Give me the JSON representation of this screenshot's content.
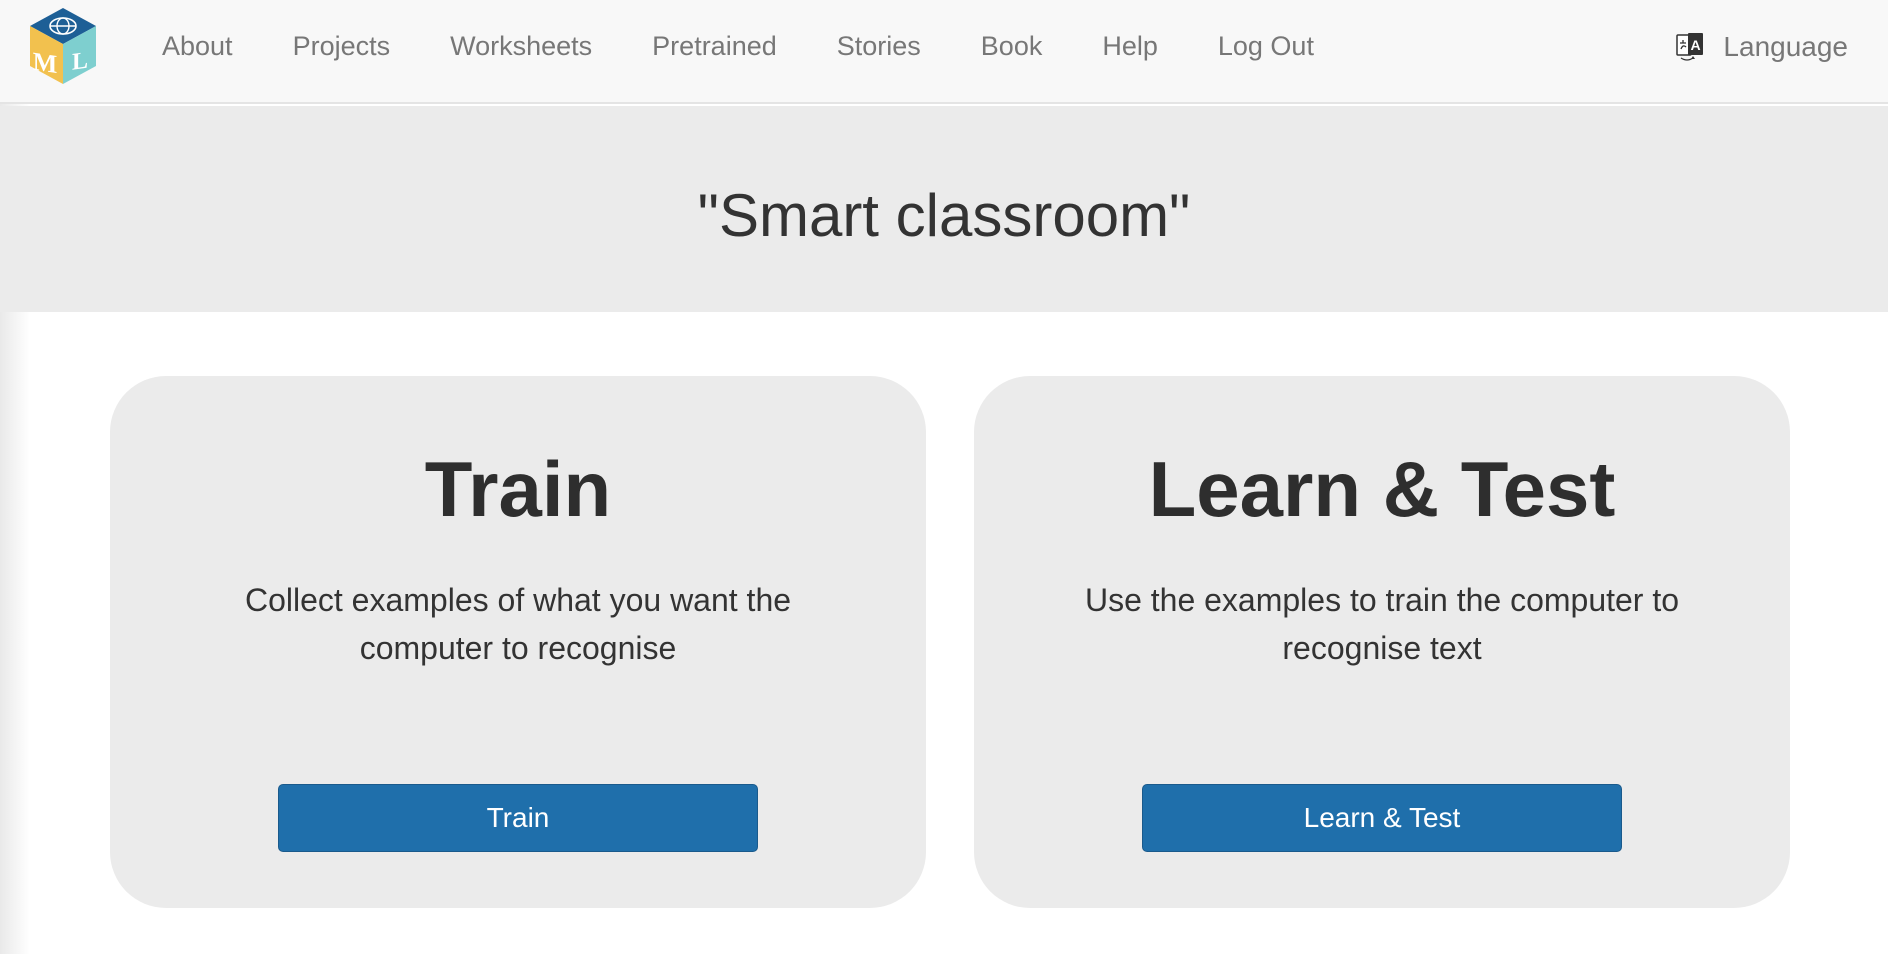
{
  "nav": {
    "logo_letters": [
      "M",
      "L"
    ],
    "links": [
      "About",
      "Projects",
      "Worksheets",
      "Pretrained",
      "Stories",
      "Book",
      "Help",
      "Log Out"
    ],
    "language_label": "Language"
  },
  "project": {
    "title": "\"Smart classroom\""
  },
  "cards": {
    "train": {
      "title": "Train",
      "description": "Collect examples of what you want the computer to recognise",
      "button": "Train"
    },
    "learn": {
      "title": "Learn & Test",
      "description": "Use the examples to train the computer to recognise text",
      "button": "Learn & Test"
    }
  },
  "colors": {
    "navbar_bg": "#f8f8f8",
    "jumbotron_bg": "#ebebeb",
    "card_bg": "#ebebeb",
    "button_bg": "#1f6fab",
    "nav_text": "#777777",
    "logo_blue": "#1d5f96",
    "logo_yellow": "#f2c14e",
    "logo_teal": "#7ecfcf"
  },
  "icons": {
    "logo": "ml-cube-logo-icon",
    "language": "translate-icon"
  }
}
